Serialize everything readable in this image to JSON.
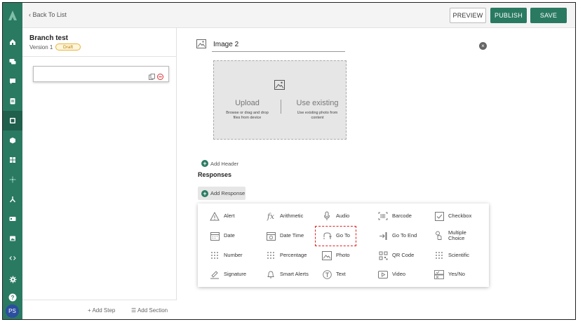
{
  "nav": {
    "back_label": "Back To List",
    "preview_label": "PREVIEW",
    "publish_label": "PUBLISH",
    "save_label": "SAVE"
  },
  "rail": {
    "icons": [
      "home-icon",
      "chat-icon",
      "message-icon",
      "clipboard-icon",
      "form-icon",
      "box-icon",
      "grid-icon",
      "settings-sparkle-icon",
      "hierarchy-icon",
      "card-icon",
      "image-icon",
      "code-icon",
      "gear-icon",
      "help-icon"
    ],
    "active_index": 4,
    "avatar_initials": "PS",
    "brand_color": "#2a7a62"
  },
  "left_panel": {
    "title": "Branch test",
    "version_label": "Version 1",
    "status_badge": "Draft",
    "add_step_label": "Add Step",
    "add_section_label": "Add Section"
  },
  "main": {
    "image_title": "Image 2",
    "upload": {
      "title": "Upload",
      "subtitle": "Browse or drag and drop files from device"
    },
    "existing": {
      "title": "Use existing",
      "subtitle": "Use existing photo from content"
    },
    "add_header_label": "Add Header",
    "responses_heading": "Responses",
    "add_response_label": "Add Response"
  },
  "response_types": [
    {
      "label": "Alert",
      "icon": "alert-icon"
    },
    {
      "label": "Arithmetic",
      "icon": "function-icon"
    },
    {
      "label": "Audio",
      "icon": "microphone-icon"
    },
    {
      "label": "Barcode",
      "icon": "barcode-icon"
    },
    {
      "label": "Checkbox",
      "icon": "checkbox-icon"
    },
    {
      "label": "Date",
      "icon": "calendar-icon"
    },
    {
      "label": "Date Time",
      "icon": "calendar-clock-icon"
    },
    {
      "label": "Go To",
      "icon": "goto-icon"
    },
    {
      "label": "Go To End",
      "icon": "goto-end-icon"
    },
    {
      "label": "Multiple Choice",
      "icon": "multiple-choice-icon"
    },
    {
      "label": "Number",
      "icon": "keypad-icon"
    },
    {
      "label": "Percentage",
      "icon": "keypad-icon"
    },
    {
      "label": "Photo",
      "icon": "photo-icon"
    },
    {
      "label": "QR Code",
      "icon": "qr-code-icon"
    },
    {
      "label": "Scientific",
      "icon": "keypad-icon"
    },
    {
      "label": "Signature",
      "icon": "signature-icon"
    },
    {
      "label": "Smart Alerts",
      "icon": "bell-icon"
    },
    {
      "label": "Text",
      "icon": "text-icon"
    },
    {
      "label": "Video",
      "icon": "video-icon"
    },
    {
      "label": "Yes/No",
      "icon": "yes-no-icon"
    }
  ],
  "highlighted_response": "Go To"
}
